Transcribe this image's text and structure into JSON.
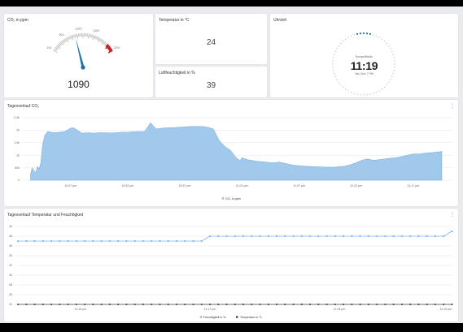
{
  "gauge": {
    "title": "CO₂ in ppm",
    "value": "1090",
    "value_num": 1090,
    "min": 400,
    "max": 2200,
    "ticks": [
      "400",
      "800",
      "1200",
      "1600",
      "2200"
    ]
  },
  "temperature": {
    "title": "Temperatur in °C",
    "value": "24"
  },
  "humidity": {
    "title": "Luftfeuchtigkeit in %",
    "value": "39"
  },
  "clock": {
    "title": "Uhrzeit",
    "location": "Europe/Berlin",
    "time": "11:19",
    "date": "Sat, Nov 7 PM"
  },
  "co2_chart": {
    "title": "Tagesverlauf CO₂",
    "y_ticks": [
      "2.5k",
      "2k",
      "1.5k",
      "1k",
      "500",
      "0"
    ],
    "x_ticks": [
      "10:47 pm",
      "10:52 pm",
      "10:57 pm",
      "11:02 pm",
      "11:07 pm",
      "11:12 pm",
      "11:17 pm"
    ],
    "legend": "CO₂ in ppm",
    "color": "#90c0e9"
  },
  "climate_chart": {
    "title": "Tagesverlauf Temperatur und Feuchtigkeit",
    "y_ticks": [
      "40",
      "38",
      "36",
      "34",
      "32",
      "30",
      "28",
      "26",
      "24"
    ],
    "x_ticks": [
      "11:16 pm",
      "11:17 pm",
      "11:18 pm",
      "11:19 pm"
    ],
    "legend_humidity": "Feuchtigkeit in %",
    "legend_temp": "Temperatur in °C",
    "humidity_color": "#7cb5ec",
    "temp_color": "#434348"
  },
  "chart_data": [
    {
      "type": "area",
      "title": "Tagesverlauf CO₂",
      "xlabel": "",
      "ylabel": "",
      "ylim": [
        0,
        2500
      ],
      "x_ticks": [
        "10:47 pm",
        "10:52 pm",
        "10:57 pm",
        "11:02 pm",
        "11:07 pm",
        "11:12 pm",
        "11:17 pm"
      ],
      "series": [
        {
          "name": "CO₂ in ppm",
          "x_minutes": [
            0,
            0.3,
            0.6,
            0.9,
            1.2,
            1.5,
            1.8,
            2.1,
            2.5,
            3.0,
            4.0,
            5.0,
            6.0,
            7.0,
            7.5,
            8.0,
            9.0,
            10.0,
            11.0,
            12.0,
            13.0,
            14.0,
            15.0,
            16.0,
            17.0,
            18.0,
            19.0,
            20.0,
            21.0,
            22.0,
            23.0,
            23.5,
            24.0,
            25.0,
            26.0,
            27.0,
            28.0,
            29.0,
            30.0,
            31.0,
            32.0,
            33.0,
            34.0,
            35.0,
            36.0,
            36.7,
            37.0,
            38.0,
            39.0,
            40.0,
            41.0,
            42.0,
            43.0,
            43.5,
            44.0,
            45.0,
            46.0,
            47.0,
            48.0,
            49.0,
            50.0,
            51.0,
            52.0,
            53.0,
            54.0,
            55.0,
            56.0,
            57.0,
            58.0,
            59.0,
            60.0,
            61.0,
            62.0,
            63.0,
            64.0,
            65.0,
            66.0,
            67.0,
            68.0,
            69.0,
            70.0,
            71.0,
            72.0
          ],
          "values": [
            250,
            500,
            380,
            300,
            550,
            450,
            700,
            1400,
            1800,
            1950,
            1900,
            1920,
            1950,
            2080,
            2100,
            2030,
            1880,
            1900,
            1880,
            1900,
            1900,
            1890,
            1900,
            1920,
            1920,
            1940,
            1950,
            1950,
            2300,
            2050,
            2080,
            2090,
            2100,
            2100,
            2120,
            2130,
            2150,
            2150,
            2150,
            2120,
            2050,
            1600,
            1350,
            1200,
            900,
            780,
            900,
            820,
            780,
            750,
            730,
            700,
            700,
            730,
            700,
            650,
            600,
            580,
            560,
            550,
            540,
            530,
            520,
            520,
            540,
            560,
            620,
            700,
            800,
            850,
            800,
            820,
            850,
            880,
            900,
            950,
            1000,
            1050,
            1050,
            1080,
            1100,
            1120,
            1150
          ]
        }
      ]
    },
    {
      "type": "line",
      "title": "Tagesverlauf Temperatur und Feuchtigkeit",
      "xlabel": "",
      "ylabel": "",
      "ylim": [
        24,
        40
      ],
      "x_ticks": [
        "11:16 pm",
        "11:17 pm",
        "11:18 pm",
        "11:19 pm"
      ],
      "x_minutes": [
        -0.1,
        0.1,
        0.3,
        0.5,
        0.7,
        0.9,
        1.1,
        1.3,
        1.5,
        1.7,
        1.9,
        2.1,
        2.3,
        2.5,
        2.7,
        2.9,
        3.1,
        3.3,
        3.5,
        3.7,
        3.9,
        4.1,
        4.3,
        4.5,
        4.7,
        4.9,
        5.1,
        5.3,
        5.5,
        5.7,
        5.9,
        6.1,
        6.3,
        6.5,
        6.7,
        6.9,
        7.1,
        7.3,
        7.5,
        7.7,
        7.9,
        8.1,
        8.3,
        8.5,
        8.7,
        8.9,
        9.1,
        9.3,
        9.5,
        9.7,
        9.9,
        10.1,
        10.3
      ],
      "series": [
        {
          "name": "Feuchtigkeit in %",
          "values": [
            37,
            37,
            37,
            37,
            37,
            37,
            37,
            37,
            37,
            37,
            37,
            37,
            37,
            37,
            37,
            37,
            37,
            37,
            37,
            37,
            37,
            37,
            37,
            38,
            38,
            38,
            38,
            38,
            38,
            38,
            38,
            38,
            38,
            38,
            38,
            38,
            38,
            38,
            38,
            38,
            38,
            38,
            38,
            38,
            38,
            38,
            38,
            38,
            38,
            38,
            38,
            38,
            39
          ]
        },
        {
          "name": "Temperatur in °C",
          "values": [
            24,
            24,
            24,
            24,
            24,
            24,
            24,
            24,
            24,
            24,
            24,
            24,
            24,
            24,
            24,
            24,
            24,
            24,
            24,
            24,
            24,
            24,
            24,
            24,
            24,
            24,
            24,
            24,
            24,
            24,
            24,
            24,
            24,
            24,
            24,
            24,
            24,
            24,
            24,
            24,
            24,
            24,
            24,
            24,
            24,
            24,
            24,
            24,
            24,
            24,
            24,
            24,
            24
          ]
        }
      ]
    }
  ]
}
